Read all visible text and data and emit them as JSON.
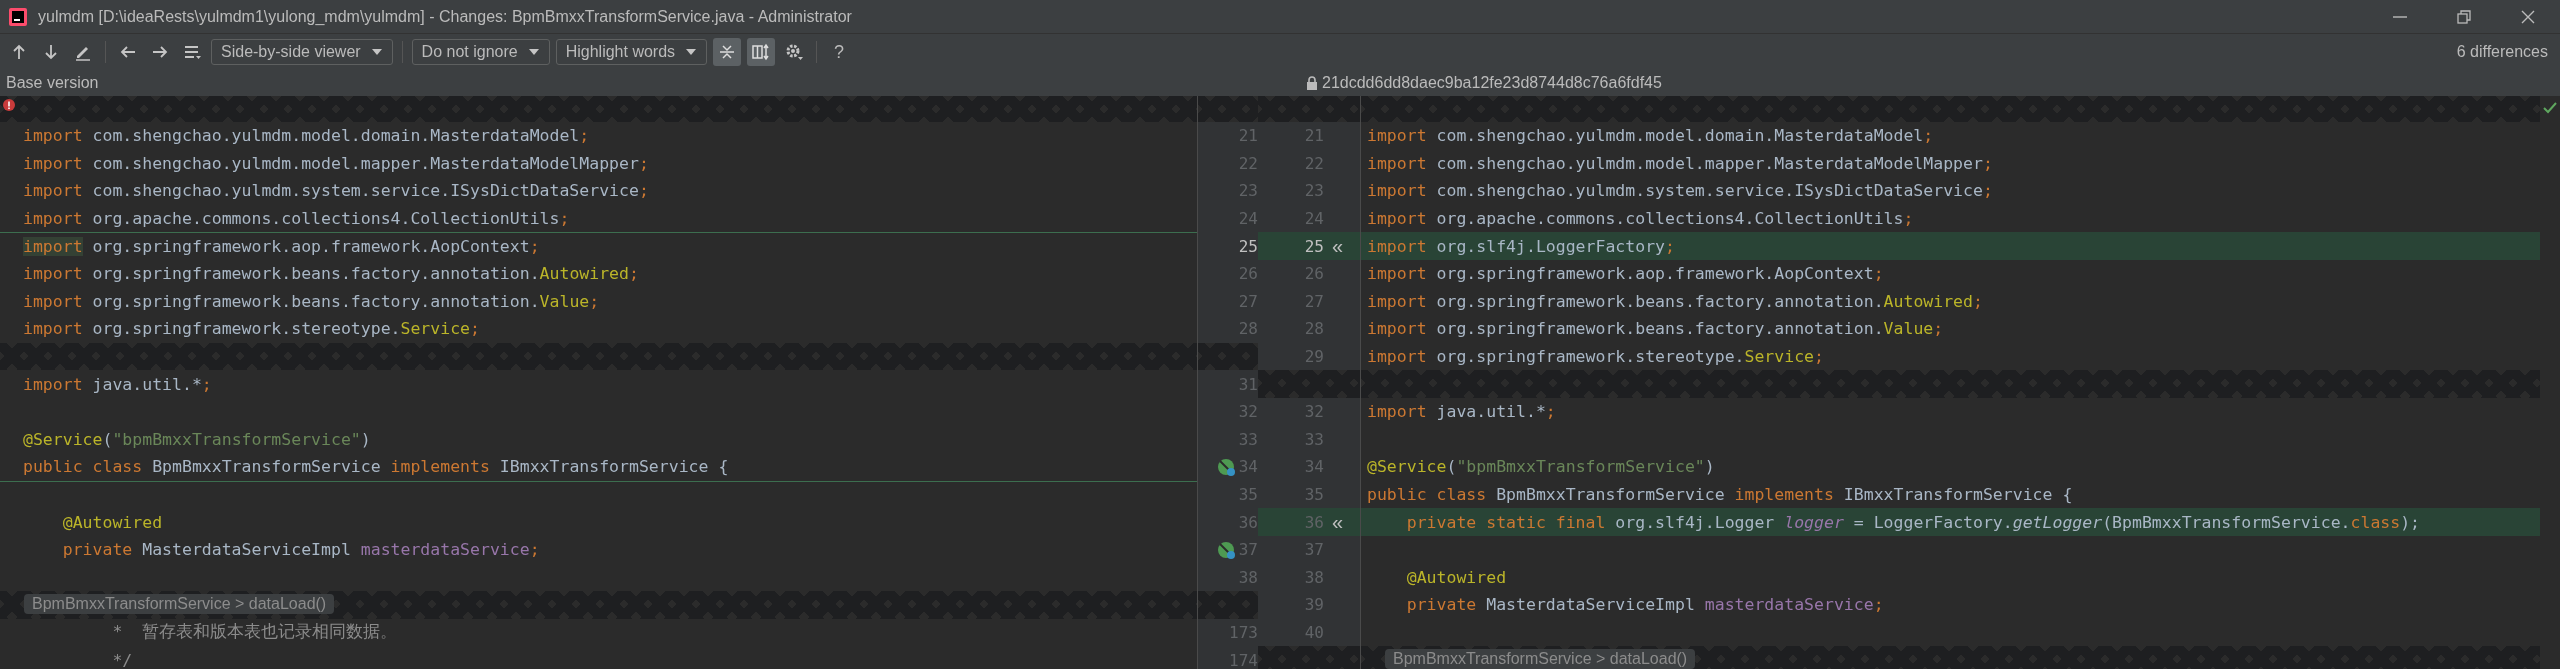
{
  "window": {
    "title": "yulmdm [D:\\ideaRests\\yulmdm1\\yulong_mdm\\yulmdm] - Changes: BpmBmxxTransformService.java - Administrator"
  },
  "toolbar": {
    "dropdowns": [
      {
        "label": "Side-by-side viewer"
      },
      {
        "label": "Do not ignore"
      },
      {
        "label": "Highlight words"
      }
    ],
    "toggles": [
      {
        "pressed": true
      },
      {
        "pressed": true
      }
    ],
    "help": "?",
    "differences": "6 differences"
  },
  "header": {
    "left": "Base version",
    "right": "21dcdd6dd8daec9ba12fe23d8744d8c76a6fdf45"
  },
  "diff": {
    "rows": [
      {
        "left": {
          "kind": "fold"
        },
        "right": {
          "kind": "fold"
        }
      },
      {
        "left_number": "21",
        "right_number": "21",
        "left": {
          "kind": "code",
          "tokens": [
            {
              "kind": "kw",
              "text": "import "
            },
            {
              "kind": "plain",
              "text": "com.shengchao.yulmdm.model.domain.MasterdataModel"
            },
            {
              "kind": "kw",
              "text": ";"
            }
          ]
        },
        "right": {
          "kind": "code",
          "tokens": [
            {
              "kind": "kw",
              "text": "import "
            },
            {
              "kind": "plain",
              "text": "com.shengchao.yulmdm.model.domain.MasterdataModel"
            },
            {
              "kind": "kw",
              "text": ";"
            }
          ]
        }
      },
      {
        "left_number": "22",
        "right_number": "22",
        "left": {
          "kind": "code",
          "tokens": [
            {
              "kind": "kw",
              "text": "import "
            },
            {
              "kind": "plain",
              "text": "com.shengchao.yulmdm.model.mapper.MasterdataModelMapper"
            },
            {
              "kind": "kw",
              "text": ";"
            }
          ]
        },
        "right": {
          "kind": "code",
          "tokens": [
            {
              "kind": "kw",
              "text": "import "
            },
            {
              "kind": "plain",
              "text": "com.shengchao.yulmdm.model.mapper.MasterdataModelMapper"
            },
            {
              "kind": "kw",
              "text": ";"
            }
          ]
        }
      },
      {
        "left_number": "23",
        "right_number": "23",
        "left": {
          "kind": "code",
          "tokens": [
            {
              "kind": "kw",
              "text": "import "
            },
            {
              "kind": "plain",
              "text": "com.shengchao.yulmdm.system.service.ISysDictDataService"
            },
            {
              "kind": "kw",
              "text": ";"
            }
          ]
        },
        "right": {
          "kind": "code",
          "tokens": [
            {
              "kind": "kw",
              "text": "import "
            },
            {
              "kind": "plain",
              "text": "com.shengchao.yulmdm.system.service.ISysDictDataService"
            },
            {
              "kind": "kw",
              "text": ";"
            }
          ]
        }
      },
      {
        "left_number": "24",
        "right_number": "24",
        "left": {
          "kind": "code",
          "tokens": [
            {
              "kind": "kw",
              "text": "import "
            },
            {
              "kind": "plain",
              "text": "org.apache.commons.collections4.CollectionUtils"
            },
            {
              "kind": "kw",
              "text": ";"
            }
          ]
        },
        "right": {
          "kind": "code",
          "tokens": [
            {
              "kind": "kw",
              "text": "import "
            },
            {
              "kind": "plain",
              "text": "org.apache.commons.collections4.CollectionUtils"
            },
            {
              "kind": "kw",
              "text": ";"
            }
          ]
        }
      },
      {
        "left_number": "25",
        "right_number": "25",
        "current": true,
        "left": {
          "kind": "code",
          "boundary": true,
          "tokens": [
            {
              "kind": "kw-hl",
              "text": "import"
            },
            {
              "kind": "plain",
              "text": " org.springframework.aop.framework.AopContext"
            },
            {
              "kind": "kw",
              "text": ";"
            }
          ]
        },
        "right": {
          "kind": "code",
          "changed": true,
          "action": "«",
          "tokens": [
            {
              "kind": "kw",
              "text": "import "
            },
            {
              "kind": "plain",
              "text": "org.slf4j.LoggerFactory"
            },
            {
              "kind": "kw",
              "text": ";"
            }
          ]
        }
      },
      {
        "left_number": "26",
        "right_number": "26",
        "left": {
          "kind": "code",
          "tokens": [
            {
              "kind": "kw",
              "text": "import "
            },
            {
              "kind": "plain",
              "text": "org.springframework.beans.factory.annotation."
            },
            {
              "kind": "ann",
              "text": "Autowired"
            },
            {
              "kind": "kw",
              "text": ";"
            }
          ]
        },
        "right": {
          "kind": "code",
          "tokens": [
            {
              "kind": "kw",
              "text": "import "
            },
            {
              "kind": "plain",
              "text": "org.springframework.aop.framework.AopContext"
            },
            {
              "kind": "kw",
              "text": ";"
            }
          ]
        }
      },
      {
        "left_number": "27",
        "right_number": "27",
        "left": {
          "kind": "code",
          "tokens": [
            {
              "kind": "kw",
              "text": "import "
            },
            {
              "kind": "plain",
              "text": "org.springframework.beans.factory.annotation."
            },
            {
              "kind": "ann",
              "text": "Value"
            },
            {
              "kind": "kw",
              "text": ";"
            }
          ]
        },
        "right": {
          "kind": "code",
          "tokens": [
            {
              "kind": "kw",
              "text": "import "
            },
            {
              "kind": "plain",
              "text": "org.springframework.beans.factory.annotation."
            },
            {
              "kind": "ann",
              "text": "Autowired"
            },
            {
              "kind": "kw",
              "text": ";"
            }
          ]
        }
      },
      {
        "left_number": "28",
        "right_number": "28",
        "left": {
          "kind": "code",
          "tokens": [
            {
              "kind": "kw",
              "text": "import "
            },
            {
              "kind": "plain",
              "text": "org.springframework.stereotype."
            },
            {
              "kind": "ann",
              "text": "Service"
            },
            {
              "kind": "kw",
              "text": ";"
            }
          ]
        },
        "right": {
          "kind": "code",
          "tokens": [
            {
              "kind": "kw",
              "text": "import "
            },
            {
              "kind": "plain",
              "text": "org.springframework.beans.factory.annotation."
            },
            {
              "kind": "ann",
              "text": "Value"
            },
            {
              "kind": "kw",
              "text": ";"
            }
          ]
        }
      },
      {
        "right_number": "29",
        "left": {
          "kind": "fold"
        },
        "right": {
          "kind": "code",
          "tokens": [
            {
              "kind": "kw",
              "text": "import "
            },
            {
              "kind": "plain",
              "text": "org.springframework.stereotype."
            },
            {
              "kind": "ann",
              "text": "Service"
            },
            {
              "kind": "kw",
              "text": ";"
            }
          ]
        }
      },
      {
        "left_number": "31",
        "left": {
          "kind": "code",
          "tokens": [
            {
              "kind": "kw",
              "text": "import "
            },
            {
              "kind": "plain",
              "text": "java.util.*"
            },
            {
              "kind": "kw",
              "text": ";"
            }
          ]
        },
        "right": {
          "kind": "fold"
        }
      },
      {
        "left_number": "32",
        "right_number": "32",
        "left": {
          "kind": "code"
        },
        "right": {
          "kind": "code",
          "tokens": [
            {
              "kind": "kw",
              "text": "import "
            },
            {
              "kind": "plain",
              "text": "java.util.*"
            },
            {
              "kind": "kw",
              "text": ";"
            }
          ]
        }
      },
      {
        "left_number": "33",
        "right_number": "33",
        "left": {
          "kind": "code",
          "tokens": [
            {
              "kind": "ann",
              "text": "@Service"
            },
            {
              "kind": "plain",
              "text": "("
            },
            {
              "kind": "str",
              "text": "\"bpmBmxxTransformService\""
            },
            {
              "kind": "plain",
              "text": ")"
            }
          ]
        },
        "right": {
          "kind": "code"
        }
      },
      {
        "left_number": "34",
        "right_number": "34",
        "gutter_mark": true,
        "left": {
          "kind": "code",
          "tokens": [
            {
              "kind": "kw",
              "text": "public class "
            },
            {
              "kind": "plain",
              "text": "BpmBmxxTransformService "
            },
            {
              "kind": "kw",
              "text": "implements "
            },
            {
              "kind": "plain",
              "text": "IBmxxTransformService {"
            }
          ]
        },
        "right": {
          "kind": "code",
          "tokens": [
            {
              "kind": "ann",
              "text": "@Service"
            },
            {
              "kind": "plain",
              "text": "("
            },
            {
              "kind": "str",
              "text": "\"bpmBmxxTransformService\""
            },
            {
              "kind": "plain",
              "text": ")"
            }
          ]
        }
      },
      {
        "left_number": "35",
        "right_number": "35",
        "left": {
          "kind": "code",
          "boundary": true
        },
        "right": {
          "kind": "code",
          "tokens": [
            {
              "kind": "kw",
              "text": "public class "
            },
            {
              "kind": "plain",
              "text": "BpmBmxxTransformService "
            },
            {
              "kind": "kw",
              "text": "implements "
            },
            {
              "kind": "plain",
              "text": "IBmxxTransformService {"
            }
          ]
        }
      },
      {
        "left_number": "36",
        "right_number": "36",
        "left": {
          "kind": "code",
          "tokens": [
            {
              "kind": "ann",
              "text": "    @Autowired"
            }
          ]
        },
        "right": {
          "kind": "code",
          "changed": true,
          "action": "«",
          "tokens": [
            {
              "kind": "kw",
              "text": "    private static final "
            },
            {
              "kind": "plain",
              "text": "org.slf4j.Logger "
            },
            {
              "kind": "field-i",
              "text": "logger"
            },
            {
              "kind": "plain",
              "text": " = LoggerFactory."
            },
            {
              "kind": "italic",
              "text": "getLogger"
            },
            {
              "kind": "plain",
              "text": "(BpmBmxxTransformService."
            },
            {
              "kind": "kw",
              "text": "class"
            },
            {
              "kind": "plain",
              "text": ");"
            }
          ]
        }
      },
      {
        "left_number": "37",
        "right_number": "37",
        "gutter_mark": true,
        "left": {
          "kind": "code",
          "tokens": [
            {
              "kind": "kw",
              "text": "    private "
            },
            {
              "kind": "plain",
              "text": "MasterdataServiceImpl "
            },
            {
              "kind": "field",
              "text": "masterdataService"
            },
            {
              "kind": "kw",
              "text": ";"
            }
          ]
        },
        "right": {
          "kind": "code"
        }
      },
      {
        "left_number": "38",
        "right_number": "38",
        "left": {
          "kind": "code"
        },
        "right": {
          "kind": "code",
          "tokens": [
            {
              "kind": "ann",
              "text": "    @Autowired"
            }
          ]
        }
      },
      {
        "right_number": "39",
        "left": {
          "kind": "fold",
          "breadcrumb": "BpmBmxxTransformService > dataLoad()"
        },
        "right": {
          "kind": "code",
          "tokens": [
            {
              "kind": "kw",
              "text": "    private "
            },
            {
              "kind": "plain",
              "text": "MasterdataServiceImpl "
            },
            {
              "kind": "field",
              "text": "masterdataService"
            },
            {
              "kind": "kw",
              "text": ";"
            }
          ]
        }
      },
      {
        "left_number": "173",
        "right_number": "40",
        "left": {
          "kind": "code",
          "tokens": [
            {
              "kind": "comment",
              "text": "         *  暂存表和版本表也记录相同数据。"
            }
          ]
        },
        "right": {
          "kind": "code"
        }
      },
      {
        "left_number": "174",
        "left": {
          "kind": "code",
          "tokens": [
            {
              "kind": "comment",
              "text": "         */"
            }
          ]
        },
        "right": {
          "kind": "fold",
          "breadcrumb": "BpmBmxxTransformService > dataLoad()"
        }
      }
    ]
  }
}
